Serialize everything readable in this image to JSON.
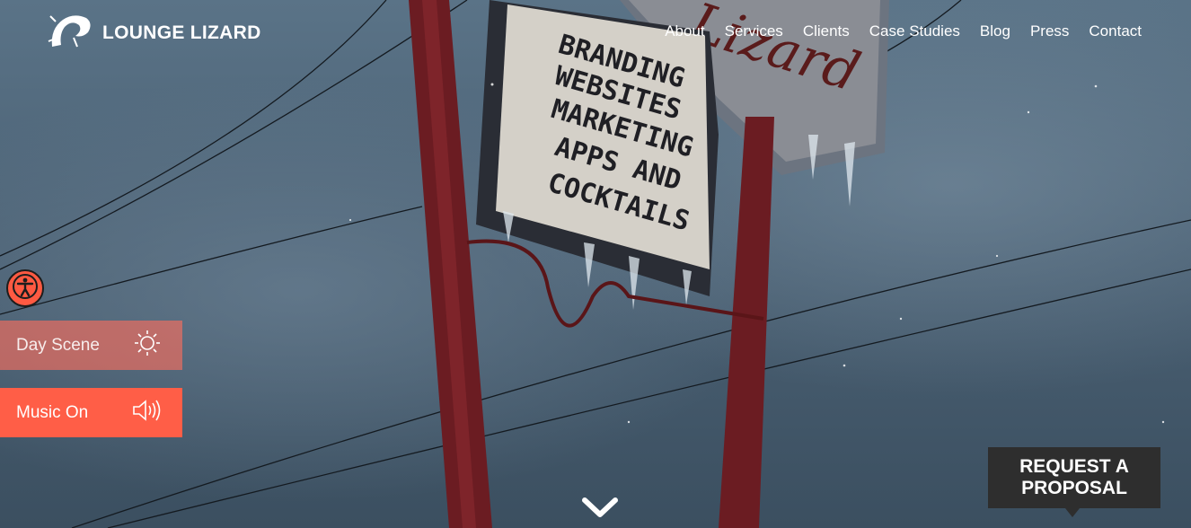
{
  "brand": {
    "name": "LOUNGE LIZARD",
    "logo_icon": "lizard-icon"
  },
  "nav": {
    "items": [
      {
        "label": "About"
      },
      {
        "label": "Services"
      },
      {
        "label": "Clients"
      },
      {
        "label": "Case Studies"
      },
      {
        "label": "Blog"
      },
      {
        "label": "Press"
      },
      {
        "label": "Contact"
      }
    ]
  },
  "hero": {
    "sign_lines": [
      "BRANDING",
      "WEBSITES",
      "MARKETING",
      "APPS AND",
      "COCKTAILS"
    ],
    "scroll_icon": "chevron-down-icon"
  },
  "controls": {
    "accessibility_icon": "accessibility-icon",
    "day_scene": {
      "label": "Day Scene",
      "icon": "sun-icon"
    },
    "music": {
      "label": "Music On",
      "icon": "speaker-icon"
    }
  },
  "cta": {
    "label": "REQUEST A PROPOSAL"
  },
  "colors": {
    "accent": "#ff5e47",
    "cta_bg": "#2e2e2e",
    "sky": "#4e6477"
  }
}
